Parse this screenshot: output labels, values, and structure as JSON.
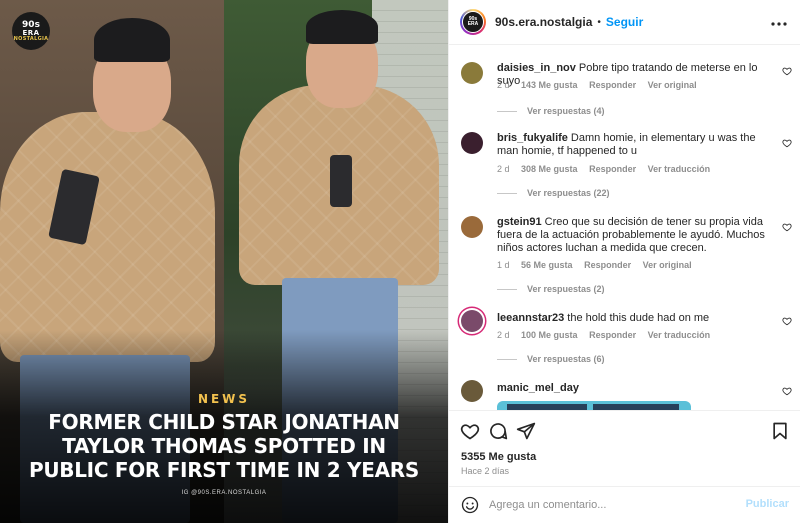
{
  "media": {
    "logo_line1": "90s",
    "logo_line2": "ERA",
    "logo_line3": "NOSTALGIA",
    "news_tag": "NEWS",
    "headline_lines": [
      "FORMER CHILD STAR JONATHAN",
      "TAYLOR THOMAS SPOTTED IN",
      "PUBLIC FOR FIRST TIME IN 2 YEARS"
    ],
    "credit": "IG @90S.ERA.NOSTALGIA"
  },
  "header": {
    "avatar_text": "90s ERA",
    "username": "90s.era.nostalgia",
    "separator": "•",
    "follow_label": "Seguir",
    "more_icon": "more-horizontal-icon"
  },
  "comments": [
    {
      "user": "daisies_in_nov",
      "text": "Pobre tipo tratando de meterse en lo suyo",
      "time": "2 d",
      "likes": "143 Me gusta",
      "reply": "Responder",
      "translate": "Ver original",
      "replies": "Ver respuestas (4)",
      "avatar_color": "#8a7a3a"
    },
    {
      "user": "bris_fukyalife",
      "text": "Damn homie, in elementary u was the man homie, tf happened to u",
      "time": "2 d",
      "likes": "308 Me gusta",
      "reply": "Responder",
      "translate": "Ver traducción",
      "replies": "Ver respuestas (22)",
      "avatar_color": "#3a1f2e"
    },
    {
      "user": "gstein91",
      "text": "Creo que su decisión de tener su propia vida fuera de la actuación probablemente le ayudó. Muchos niños actores luchan a medida que crecen.",
      "time": "1 d",
      "likes": "56 Me gusta",
      "reply": "Responder",
      "translate": "Ver original",
      "replies": "Ver respuestas (2)",
      "avatar_color": "#9a6a3a"
    },
    {
      "user": "leeannstar23",
      "text": "the hold this dude had on me",
      "time": "2 d",
      "likes": "100 Me gusta",
      "reply": "Responder",
      "translate": "Ver traducción",
      "replies": "Ver respuestas (6)",
      "avatar_color": "#7a4a6a"
    },
    {
      "user": "manic_mel_day",
      "text": "",
      "avatar_color": "#6a5a3a"
    }
  ],
  "actions": {
    "like_icon": "heart-icon",
    "comment_icon": "comment-icon",
    "share_icon": "send-icon",
    "save_icon": "bookmark-icon",
    "likes": "5355 Me gusta",
    "ago": "Hace 2 días"
  },
  "add_comment": {
    "emoji_icon": "emoji-icon",
    "placeholder": "Agrega un comentario...",
    "publish_label": "Publicar"
  },
  "colors": {
    "link_blue": "#0095f6",
    "publish_disabled": "#b2dffc",
    "news_gold": "#f2c14e"
  }
}
